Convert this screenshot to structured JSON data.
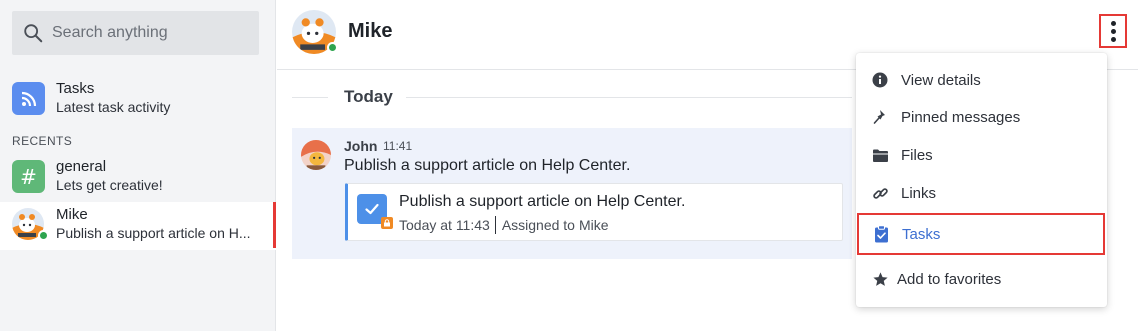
{
  "search": {
    "placeholder": "Search anything",
    "icon": "search-icon"
  },
  "sidebar": {
    "tasks_item": {
      "title": "Tasks",
      "subtitle": "Latest task activity",
      "icon": "rss-icon",
      "color": "#5b8def"
    },
    "recents_label": "RECENTS",
    "items": [
      {
        "title": "general",
        "subtitle": "Lets get creative!",
        "icon": "hash-icon",
        "color": "#5fb878"
      },
      {
        "title": "Mike",
        "subtitle": "Publish a support article on H...",
        "icon": "avatar",
        "status": "online",
        "active": true
      }
    ]
  },
  "header": {
    "name": "Mike",
    "status": "online",
    "menu_icon": "kebab-menu-icon"
  },
  "conversation": {
    "day_separator": "Today",
    "message": {
      "author": "John",
      "time": "11:41",
      "text": "Publish a support article on Help Center.",
      "task": {
        "title": "Publish a support article on Help Center.",
        "when": "Today at 11:43",
        "assigned_label": "Assigned to",
        "assignee": "Mike"
      }
    }
  },
  "menu": {
    "items": [
      {
        "label": "View details",
        "icon": "info-icon"
      },
      {
        "label": "Pinned messages",
        "icon": "pin-icon"
      },
      {
        "label": "Files",
        "icon": "folder-icon"
      },
      {
        "label": "Links",
        "icon": "link-icon"
      },
      {
        "label": "Tasks",
        "icon": "clipboard-check-icon",
        "highlighted": true
      },
      {
        "label": "Add to favorites",
        "icon": "star-icon"
      }
    ]
  },
  "colors": {
    "accent": "#3d6fd1",
    "highlight_border": "#e53935",
    "online": "#2ea44f"
  }
}
